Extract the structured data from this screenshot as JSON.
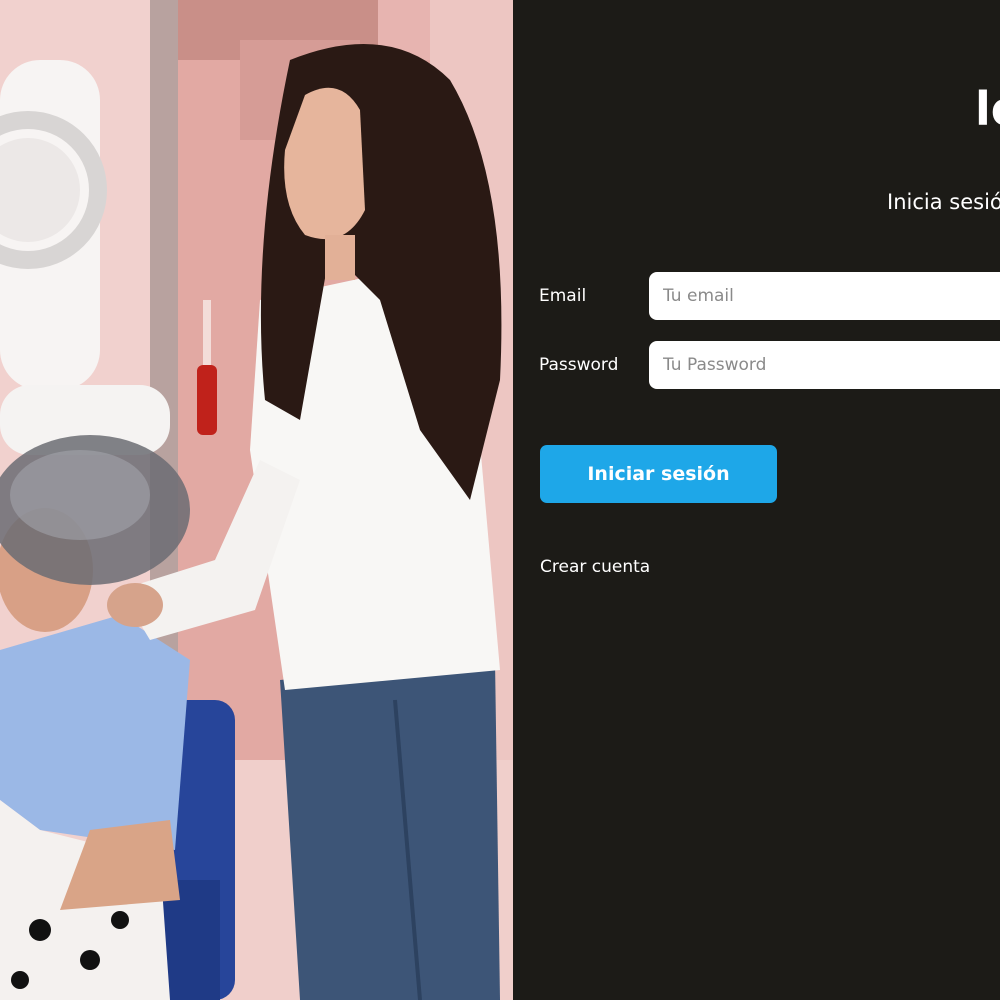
{
  "brand": {
    "text": "lo"
  },
  "login": {
    "subtitle": "Inicia sesió",
    "email_label": "Email",
    "email_placeholder": "Tu email",
    "email_value": "",
    "password_label": "Password",
    "password_placeholder": "Tu Password",
    "password_value": "",
    "submit_label": "Iniciar sesión",
    "create_account_label": "Crear cuenta"
  },
  "colors": {
    "panel_background": "#1c1b17",
    "submit_button": "#1ea7e8",
    "text": "#ffffff"
  }
}
